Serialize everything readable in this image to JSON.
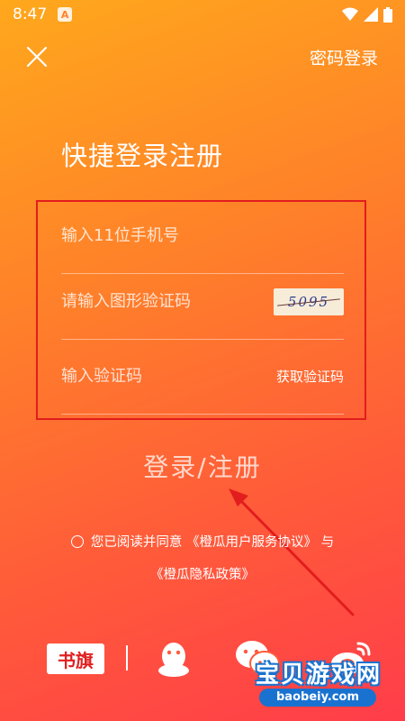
{
  "status_bar": {
    "time": "8:47",
    "notification_badge": "A"
  },
  "header": {
    "close_icon": "close-icon",
    "password_login_label": "密码登录"
  },
  "title": "快捷登录注册",
  "form": {
    "phone_placeholder": "输入11位手机号",
    "captcha_placeholder": "请输入图形验证码",
    "captcha_image_text": "5095",
    "code_placeholder": "输入验证码",
    "get_code_label": "获取验证码"
  },
  "submit_label": "登录/注册",
  "agreement": {
    "prefix": "您已阅读并同意",
    "service_link": "《橙瓜用户服务协议》",
    "conjunction": "与",
    "privacy_link": "《橙瓜隐私政策》"
  },
  "social": {
    "shuqi_label": "书旗",
    "icons": [
      "shuqi-icon",
      "qq-icon",
      "wechat-icon",
      "weibo-icon"
    ]
  },
  "watermark": {
    "text": "宝贝游戏网",
    "url": "baobeiy.com"
  },
  "colors": {
    "highlight_border": "#e21d1d",
    "watermark_blue": "#1a72d0",
    "gradient_top": "#ffa81c",
    "gradient_bottom": "#ff3d4a"
  }
}
